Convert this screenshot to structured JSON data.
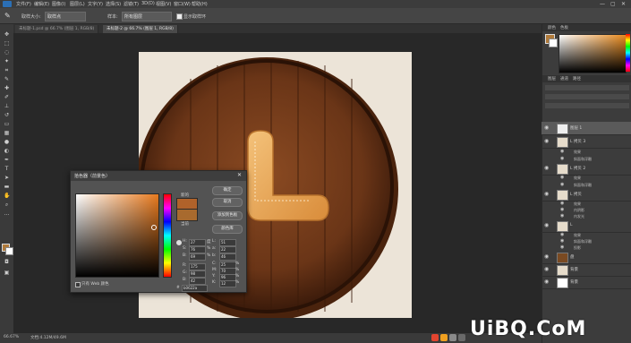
{
  "menubar": {
    "logo": "Ps",
    "items": [
      "文件(F)",
      "编辑(E)",
      "图像(I)",
      "图层(L)",
      "文字(Y)",
      "选择(S)",
      "滤镜(T)",
      "3D(D)",
      "视图(V)",
      "窗口(W)",
      "帮助(H)"
    ],
    "window_controls": [
      "—",
      "▢",
      "✕"
    ]
  },
  "options": {
    "sample_size_label": "取样大小:",
    "sample_size_value": "取样点",
    "sample_label": "样本:",
    "sample_value": "所有图层",
    "show_ring_label": "显示取样环"
  },
  "tabs": [
    {
      "label": "未标题-1.psd @ 66.7% (图层 1, RGB/8)",
      "active": false
    },
    {
      "label": "未标题-2 @ 66.7% (图层 1, RGB/8)",
      "active": true
    }
  ],
  "status": {
    "zoom": "66.67%",
    "doc_info": "文档:4.12M/49.6M"
  },
  "right_panel": {
    "top_tabs": [
      "颜色",
      "色板"
    ],
    "layer_tabs": [
      "图层",
      "通道",
      "路径"
    ],
    "layers": [
      {
        "label": "图层 1",
        "kind": "layer"
      },
      {
        "label": "L 拷贝 3",
        "kind": "layer"
      },
      {
        "label": "效果",
        "kind": "fx"
      },
      {
        "label": "斜面和浮雕",
        "kind": "fx"
      },
      {
        "label": "L 拷贝 2",
        "kind": "layer"
      },
      {
        "label": "效果",
        "kind": "fx"
      },
      {
        "label": "斜面和浮雕",
        "kind": "fx"
      },
      {
        "label": "L 拷贝",
        "kind": "layer"
      },
      {
        "label": "效果",
        "kind": "fx"
      },
      {
        "label": "内阴影",
        "kind": "fx"
      },
      {
        "label": "内发光",
        "kind": "fx"
      },
      {
        "label": "L",
        "kind": "layer"
      },
      {
        "label": "效果",
        "kind": "fx"
      },
      {
        "label": "斜面和浮雕",
        "kind": "fx"
      },
      {
        "label": "投影",
        "kind": "fx"
      },
      {
        "label": "盘",
        "kind": "layer"
      },
      {
        "label": "背景",
        "kind": "layer"
      },
      {
        "label": "背景",
        "kind": "layer"
      }
    ]
  },
  "color_picker": {
    "title": "拾色器（前景色）",
    "new_label": "新的",
    "current_label": "当前",
    "buttons": [
      "确定",
      "取消",
      "添加到色板",
      "颜色库"
    ],
    "web_only_label": "只有 Web 颜色",
    "fields": {
      "H": "27",
      "S": "76",
      "B": "69",
      "R": "175",
      "G": "98",
      "Bv": "42",
      "L": "51",
      "a": "22",
      "b": "46",
      "C": "25",
      "M": "70",
      "Y": "96",
      "K": "12"
    },
    "hex": "b0622a",
    "units": {
      "deg": "度",
      "pct": "%"
    },
    "new_color": "#b0622a",
    "current_color": "#a86a2e"
  },
  "watermark": "UiBQ.CoM"
}
